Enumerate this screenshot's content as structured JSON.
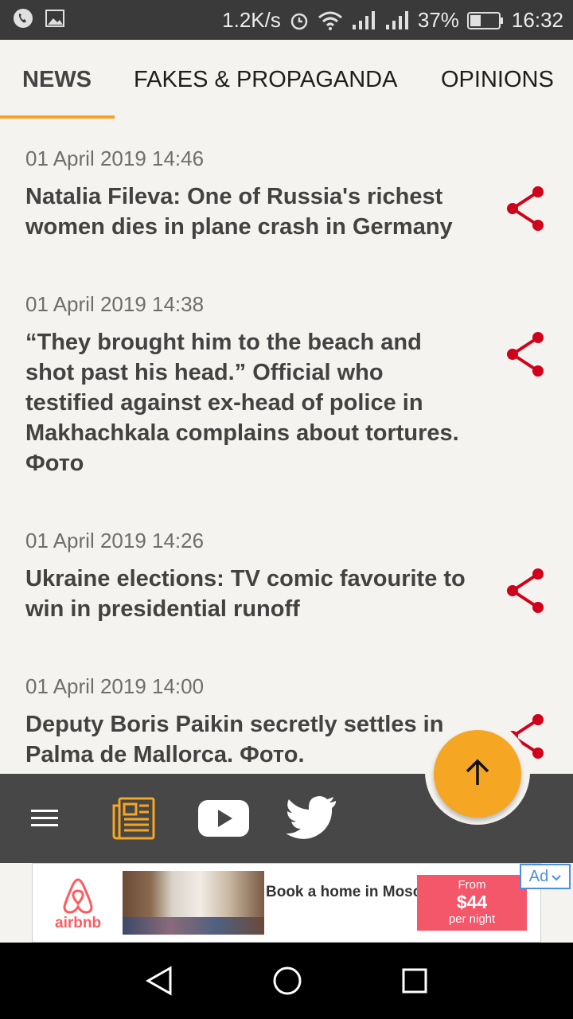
{
  "status_bar": {
    "speed": "1.2K/s",
    "battery_percent": "37%",
    "time": "16:32",
    "icons": [
      "phone-icon",
      "image-icon",
      "alarm-icon",
      "wifi-icon",
      "signal-icon",
      "signal-icon",
      "battery-icon"
    ]
  },
  "tabs": [
    {
      "label": "NEWS",
      "active": true
    },
    {
      "label": "FAKES & PROPAGANDA",
      "active": false
    },
    {
      "label": "OPINIONS",
      "active": false
    }
  ],
  "accent_color": "#f7a12a",
  "share_color": "#d0021b",
  "news": [
    {
      "date": "01 April 2019 14:46",
      "title": "Natalia Fileva: One of Russia's richest women dies in plane crash in Germany"
    },
    {
      "date": "01 April 2019 14:38",
      "title": "“They brought him to the beach and shot past his head.” Official who testified against ex-head of police in Makhachkala complains about tortures. Фото"
    },
    {
      "date": "01 April 2019 14:26",
      "title": "Ukraine elections: TV comic favourite to win in presidential runoff"
    },
    {
      "date": "01 April 2019 14:00",
      "title": "Deputy Boris Paikin secretly settles in Palma de Mallorca. Фото."
    }
  ],
  "bottom_nav": {
    "items": [
      "menu-icon",
      "newspaper-icon",
      "youtube-icon",
      "twitter-icon"
    ],
    "fab": "arrow-up-icon"
  },
  "ad": {
    "brand": "airbnb",
    "text": "Book a home in Moscow",
    "price_from": "From",
    "price": "$44",
    "price_unit": "per night",
    "label": "Ad"
  }
}
